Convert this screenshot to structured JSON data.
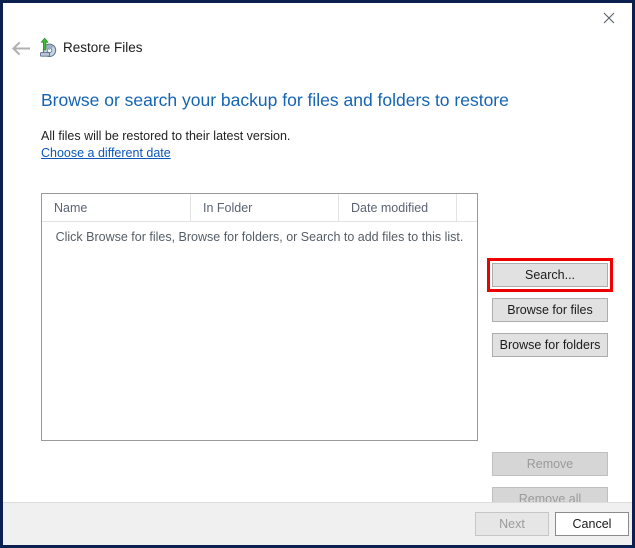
{
  "window": {
    "title": "Restore Files",
    "close_label": "×",
    "back_label": "←",
    "app_icon": "restore-files-icon"
  },
  "content": {
    "heading": "Browse or search your backup for files and folders to restore",
    "subtext": "All files will be restored to their latest version.",
    "date_link": "Choose a different date"
  },
  "file_list": {
    "columns": [
      {
        "label": "Name"
      },
      {
        "label": "In Folder"
      },
      {
        "label": "Date modified"
      },
      {
        "label": ""
      }
    ],
    "empty_message": "Click Browse for files, Browse for folders, or Search to add files to this list.",
    "rows": []
  },
  "side_buttons": [
    {
      "label": "Search...",
      "enabled": true,
      "highlighted": true
    },
    {
      "label": "Browse for files",
      "enabled": true,
      "highlighted": false
    },
    {
      "label": "Browse for folders",
      "enabled": true,
      "highlighted": false
    },
    {
      "label": "Remove",
      "enabled": false,
      "highlighted": false
    },
    {
      "label": "Remove all",
      "enabled": false,
      "highlighted": false
    }
  ],
  "footer": {
    "next_label": "Next",
    "next_enabled": false,
    "cancel_label": "Cancel",
    "cancel_enabled": true
  },
  "colors": {
    "window_border": "#0c2050",
    "heading_blue": "#1464b4",
    "link_blue": "#0c57b8",
    "highlight_red": "#ee0000",
    "button_face": "#e1e1e1",
    "footer_bg": "#f0f0f0",
    "column_header_text": "#5a6472"
  }
}
